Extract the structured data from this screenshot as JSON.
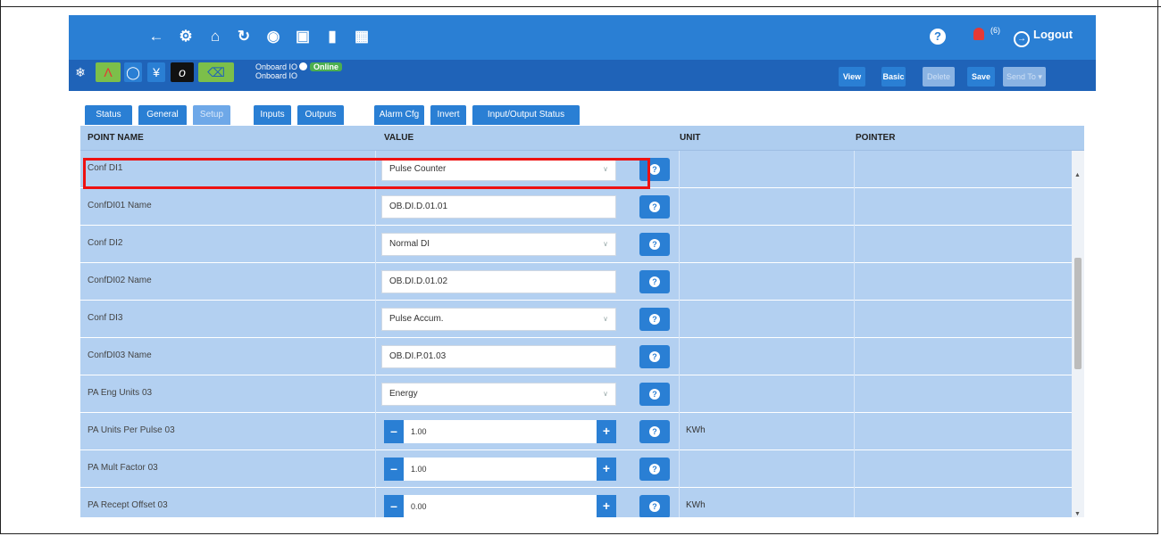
{
  "notifications": {
    "count": "(6)"
  },
  "header": {
    "logout_label": "Logout"
  },
  "device": {
    "name_line1": "Onboard IO",
    "name_line2": "Onboard IO",
    "status": "Online"
  },
  "actions": {
    "view": "View",
    "basic": "Basic",
    "delete": "Delete",
    "save": "Save",
    "send_to": "Send To ▾"
  },
  "tabs": [
    "Status",
    "General",
    "Setup",
    "Inputs",
    "Outputs",
    "Alarm Cfg",
    "Invert",
    "Input/Output Status"
  ],
  "active_tab": "Setup",
  "table": {
    "columns": {
      "point_name": "POINT NAME",
      "value": "VALUE",
      "unit": "UNIT",
      "pointer": "POINTER"
    },
    "rows": [
      {
        "name": "Conf DI1",
        "type": "select",
        "value": "Pulse Counter",
        "unit": ""
      },
      {
        "name": "ConfDI01 Name",
        "type": "text",
        "value": "OB.DI.D.01.01",
        "unit": ""
      },
      {
        "name": "Conf DI2",
        "type": "select",
        "value": "Normal DI",
        "unit": ""
      },
      {
        "name": "ConfDI02 Name",
        "type": "text",
        "value": "OB.DI.D.01.02",
        "unit": ""
      },
      {
        "name": "Conf DI3",
        "type": "select",
        "value": "Pulse Accum.",
        "unit": ""
      },
      {
        "name": "ConfDI03 Name",
        "type": "text",
        "value": "OB.DI.P.01.03",
        "unit": ""
      },
      {
        "name": "PA Eng Units 03",
        "type": "select",
        "value": "Energy",
        "unit": ""
      },
      {
        "name": "PA Units Per Pulse 03",
        "type": "number",
        "value": "1.00",
        "unit": "KWh"
      },
      {
        "name": "PA Mult Factor 03",
        "type": "number",
        "value": "1.00",
        "unit": ""
      },
      {
        "name": "PA Recept Offset 03",
        "type": "number",
        "value": "0.00",
        "unit": "KWh"
      }
    ]
  },
  "colors": {
    "topbar": "#2a7fd4",
    "subbar": "#1f63b8",
    "row": "#b3d0f1",
    "highlight": "#e11111",
    "online": "#4caf50"
  }
}
